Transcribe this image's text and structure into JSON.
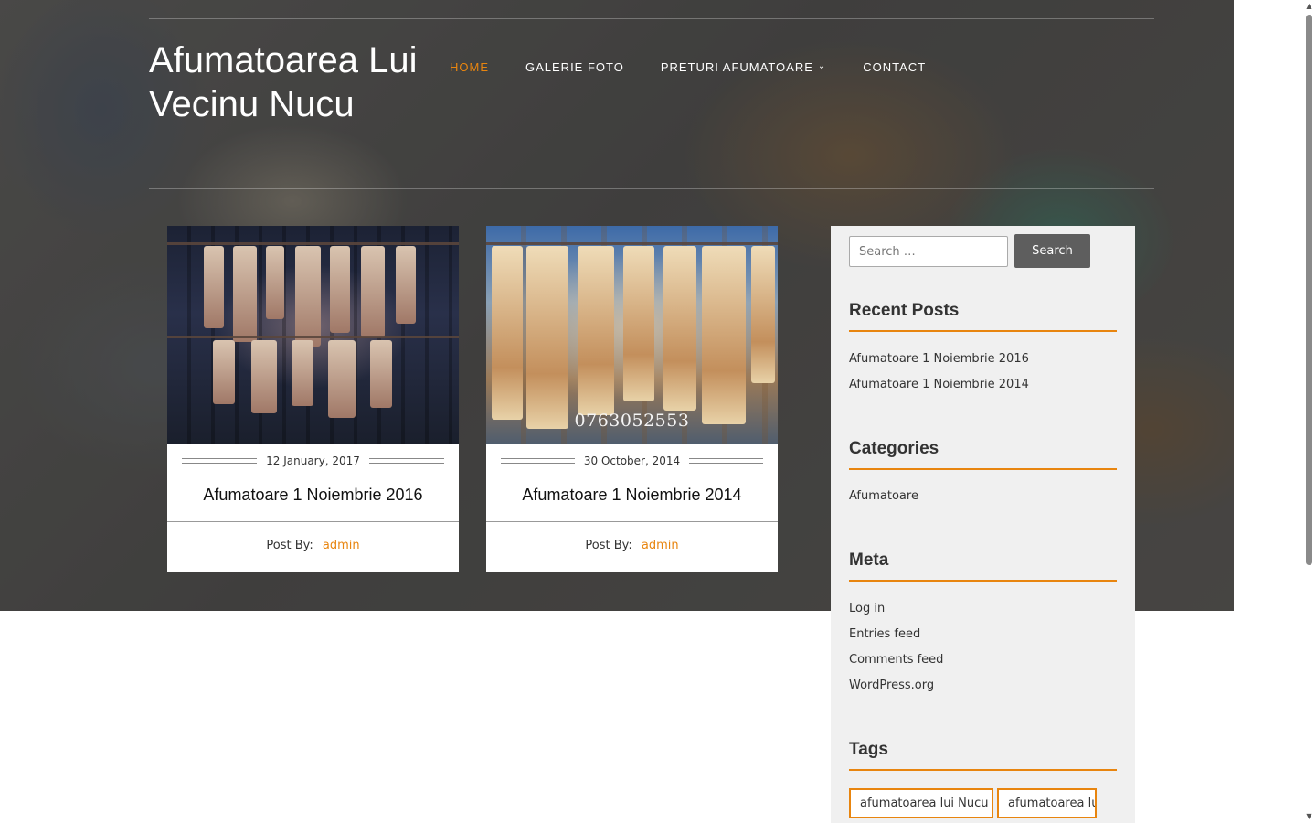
{
  "site": {
    "title": "Afumatoarea Lui Vecinu Nucu"
  },
  "nav": {
    "items": [
      {
        "label": "HOME",
        "active": true
      },
      {
        "label": "GALERIE FOTO",
        "active": false
      },
      {
        "label": "PRETURI AFUMATOARE",
        "active": false,
        "has_dropdown": true
      },
      {
        "label": "CONTACT",
        "active": false
      }
    ]
  },
  "posts": [
    {
      "date": "12 January, 2017",
      "title": "Afumatoare 1 Noiembrie 2016",
      "byline": "Post By:",
      "author": "admin"
    },
    {
      "date": "30 October, 2014",
      "title": "Afumatoare 1 Noiembrie 2014",
      "byline": "Post By:",
      "author": "admin",
      "image_text": "0763052553"
    }
  ],
  "sidebar": {
    "search": {
      "placeholder": "Search …",
      "button": "Search"
    },
    "recent_posts": {
      "title": "Recent Posts",
      "items": [
        "Afumatoare 1 Noiembrie 2016",
        "Afumatoare 1 Noiembrie 2014"
      ]
    },
    "categories": {
      "title": "Categories",
      "items": [
        "Afumatoare"
      ]
    },
    "meta": {
      "title": "Meta",
      "items": [
        "Log in",
        "Entries feed",
        "Comments feed",
        "WordPress.org"
      ]
    },
    "tags": {
      "title": "Tags",
      "items": [
        "afumatoarea lui Nucu",
        "afumatoarea lui"
      ]
    }
  },
  "colors": {
    "accent": "#e8850f",
    "sidebar_bg": "#f0f0f0",
    "button_bg": "#5e5e5e"
  }
}
